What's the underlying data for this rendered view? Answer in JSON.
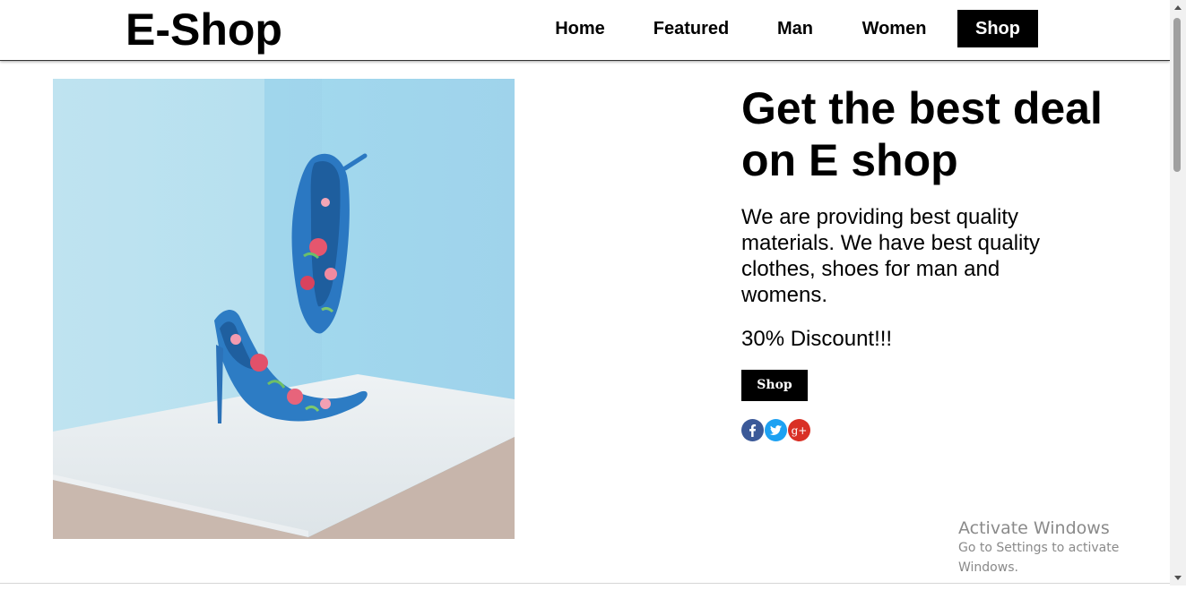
{
  "header": {
    "logo": "E-Shop",
    "nav": [
      {
        "label": "Home",
        "active": false
      },
      {
        "label": "Featured",
        "active": false
      },
      {
        "label": "Man",
        "active": false
      },
      {
        "label": "Women",
        "active": false
      },
      {
        "label": "Shop",
        "active": true
      }
    ]
  },
  "hero": {
    "headline": "Get the best deal on E shop",
    "description": "We are providing best quality materials. We have best quality clothes, shoes for man and womens.",
    "discount": "30% Discount!!!",
    "button_label": "Shop",
    "social": [
      {
        "icon": "facebook-icon",
        "color": "#3b5998",
        "glyph": "f"
      },
      {
        "icon": "twitter-icon",
        "color": "#1da1f2",
        "glyph": "t"
      },
      {
        "icon": "google-plus-icon",
        "color": "#d93025",
        "glyph": "g+"
      }
    ],
    "image": {
      "subject": "blue floral high-heel shoes on a white pedestal",
      "colors": {
        "wall": "#a9ddee",
        "floor": "#e6ecef",
        "shoe": "#2d7cc4"
      }
    }
  },
  "watermark": {
    "title": "Activate Windows",
    "subtitle": "Go to Settings to activate Windows."
  }
}
